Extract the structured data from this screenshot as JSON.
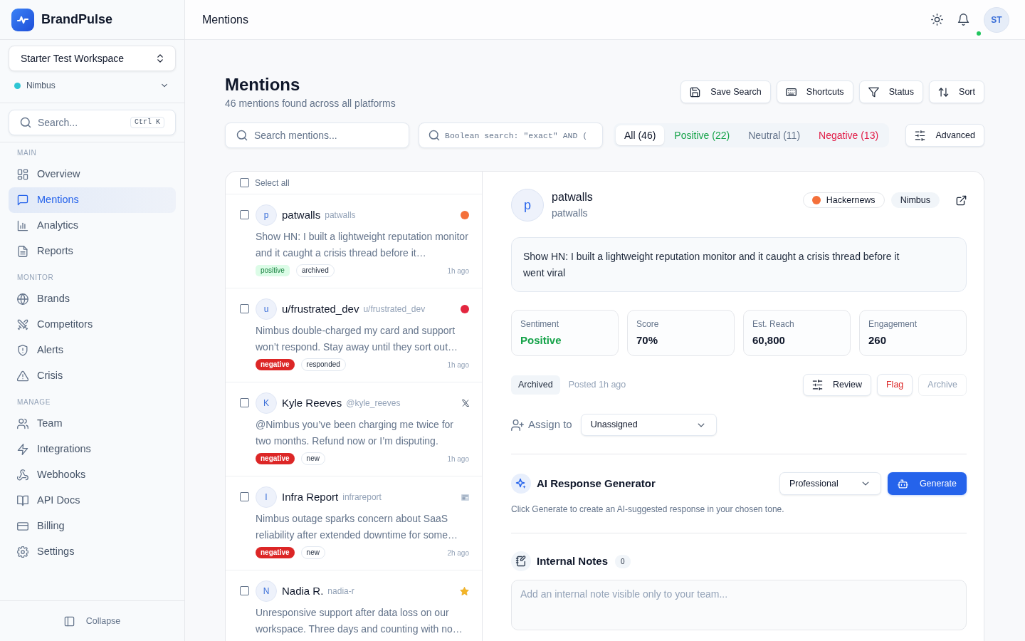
{
  "sidebar": {
    "brand": "BrandPulse",
    "workspace": "Starter Test Workspace",
    "brand_filter": {
      "label": "Nimbus",
      "color": "#2ec5d3"
    },
    "search": {
      "placeholder": "Search...",
      "shortcut": "Ctrl K"
    },
    "sections": [
      {
        "title": "MAIN",
        "items": [
          {
            "label": "Overview",
            "selected": false
          },
          {
            "label": "Mentions",
            "selected": true
          },
          {
            "label": "Analytics",
            "selected": false
          },
          {
            "label": "Reports",
            "selected": false
          }
        ]
      },
      {
        "title": "MONITOR",
        "items": [
          {
            "label": "Brands",
            "selected": false
          },
          {
            "label": "Competitors",
            "selected": false
          },
          {
            "label": "Alerts",
            "selected": false
          },
          {
            "label": "Crisis",
            "selected": false
          }
        ]
      },
      {
        "title": "MANAGE",
        "items": [
          {
            "label": "Team",
            "selected": false
          },
          {
            "label": "Integrations",
            "selected": false
          },
          {
            "label": "Webhooks",
            "selected": false
          },
          {
            "label": "API Docs",
            "selected": false
          },
          {
            "label": "Billing",
            "selected": false
          },
          {
            "label": "Settings",
            "selected": false
          }
        ]
      }
    ],
    "collapse": "Collapse"
  },
  "header": {
    "title": "Mentions",
    "user": {
      "initials": "ST",
      "online": true
    }
  },
  "page": {
    "title": "Mentions",
    "subtitle": "46 mentions found across all platforms",
    "actions": [
      "Save Search",
      "Shortcuts",
      "Status",
      "Sort"
    ]
  },
  "filters": {
    "search": {
      "placeholder": "Search mentions..."
    },
    "boolean_search": {
      "placeholder": "Boolean search: \"exact\" AND ("
    },
    "sentiment_tabs": [
      {
        "label": "All (46)",
        "color": "#0f172a",
        "selected": true
      },
      {
        "label": "Positive (22)",
        "color": "#16a34a",
        "selected": false
      },
      {
        "label": "Neutral (11)",
        "color": "#64748b",
        "selected": false
      },
      {
        "label": "Negative (13)",
        "color": "#e11d48",
        "selected": false
      }
    ],
    "advanced": {
      "label": "Advanced"
    }
  },
  "mentions": {
    "select_all": {
      "label": "Select all",
      "checked": false
    },
    "items": [
      {
        "initial": "p",
        "name": "patwalls",
        "handle": "patwalls",
        "source": {
          "kind": "dot",
          "color": "#f4703a"
        },
        "text": "Show HN: I built a lightweight reputation monitor and it caught a crisis thread before it…",
        "sentiment": {
          "label": "positive",
          "kind": "positive"
        },
        "status": "archived",
        "time": "1h ago",
        "checked": false
      },
      {
        "initial": "u",
        "name": "u/frustrated_dev",
        "handle": "u/frustrated_dev",
        "source": {
          "kind": "dot",
          "color": "#e3263f"
        },
        "text": "Nimbus double-charged my card and support won’t respond. Stay away until they sort out…",
        "sentiment": {
          "label": "negative",
          "kind": "negative"
        },
        "status": "responded",
        "time": "1h ago",
        "checked": false
      },
      {
        "initial": "K",
        "name": "Kyle Reeves",
        "handle": "@kyle_reeves",
        "source": {
          "kind": "x"
        },
        "text": "@Nimbus you’ve been charging me twice for two months. Refund now or I’m disputing.",
        "sentiment": {
          "label": "negative",
          "kind": "negative"
        },
        "status": "new",
        "time": "1h ago",
        "checked": false
      },
      {
        "initial": "I",
        "name": "Infra Report",
        "handle": "infrareport",
        "source": {
          "kind": "news"
        },
        "text": "Nimbus outage sparks concern about SaaS reliability after extended downtime for some…",
        "sentiment": {
          "label": "negative",
          "kind": "negative"
        },
        "status": "new",
        "time": "2h ago",
        "checked": false
      },
      {
        "initial": "N",
        "name": "Nadia R.",
        "handle": "nadia-r",
        "source": {
          "kind": "star"
        },
        "text": "Unresponsive support after data loss on our workspace. Three days and counting with no…",
        "checked": false
      }
    ]
  },
  "detail": {
    "initial": "p",
    "name": "patwalls",
    "handle": "patwalls",
    "source": {
      "label": "Hackernews",
      "color": "#f4703a"
    },
    "brand": "Nimbus",
    "text": "Show HN: I built a lightweight reputation monitor and it caught a crisis thread before it went viral",
    "stats": [
      {
        "label": "Sentiment",
        "value": "Positive",
        "kind": "positive"
      },
      {
        "label": "Score",
        "value": "70%",
        "kind": "plain"
      },
      {
        "label": "Est. Reach",
        "value": "60,800",
        "kind": "plain"
      },
      {
        "label": "Engagement",
        "value": "260",
        "kind": "plain"
      }
    ],
    "status": "Archived",
    "posted": "Posted 1h ago",
    "actions": [
      {
        "label": "Review",
        "kind": "review",
        "disabled": false
      },
      {
        "label": "Flag",
        "kind": "danger",
        "disabled": false
      },
      {
        "label": "Archive",
        "kind": "plain",
        "disabled": true
      }
    ],
    "assign": {
      "label": "Assign to",
      "value": "Unassigned"
    },
    "ai": {
      "title": "AI Response Generator",
      "tone": "Professional",
      "button": "Generate",
      "hint": "Click Generate to create an AI-suggested response in your chosen tone."
    },
    "notes": {
      "title": "Internal Notes",
      "count": "0",
      "placeholder": "Add an internal note visible only to your team..."
    }
  }
}
